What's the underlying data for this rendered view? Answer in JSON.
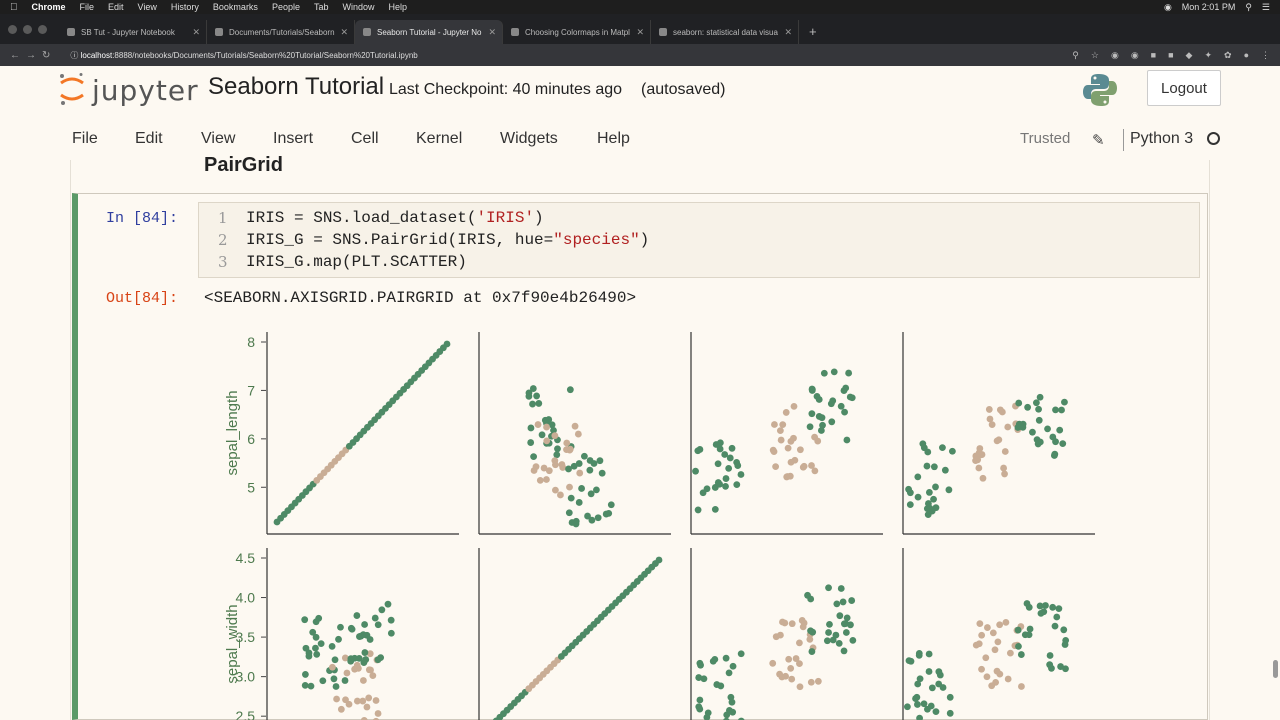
{
  "os_menubar": {
    "app": "Chrome",
    "items": [
      "File",
      "Edit",
      "View",
      "History",
      "Bookmarks",
      "People",
      "Tab",
      "Window",
      "Help"
    ],
    "clock": "Mon 2:01 PM"
  },
  "browser": {
    "tabs": [
      {
        "title": "SB Tut - Jupyter Notebook",
        "active": false
      },
      {
        "title": "Documents/Tutorials/Seaborn",
        "active": false
      },
      {
        "title": "Seaborn Tutorial - Jupyter No",
        "active": true
      },
      {
        "title": "Choosing Colormaps in Matpl",
        "active": false
      },
      {
        "title": "seaborn: statistical data visua",
        "active": false
      }
    ],
    "url_host": "localhost",
    "url_rest": ":8888/notebooks/Documents/Tutorials/Seaborn%20Tutorial/Seaborn%20Tutorial.ipynb"
  },
  "jupyter": {
    "logo_text": "jupyter",
    "notebook_title": "Seaborn Tutorial",
    "checkpoint": "Last Checkpoint: 40 minutes ago",
    "autosaved": "(autosaved)",
    "logout": "Logout",
    "menu": [
      "File",
      "Edit",
      "View",
      "Insert",
      "Cell",
      "Kernel",
      "Widgets",
      "Help"
    ],
    "trusted": "Trusted",
    "kernel_name": "Python 3"
  },
  "notebook": {
    "heading": "PairGrid",
    "in_prompt": "In [84]:",
    "code_lines": [
      {
        "n": "1",
        "text": "IRIS = SNS.load_dataset(",
        "str": "'IRIS'",
        "tail": ")"
      },
      {
        "n": "2",
        "text": "IRIS_G = SNS.PairGrid(IRIS, hue=",
        "str": "\"species\"",
        "tail": ")"
      },
      {
        "n": "3",
        "text": "IRIS_G.map(PLT.SCATTER)",
        "str": "",
        "tail": ""
      }
    ],
    "out_prompt": "Out[84]:",
    "out_text": "<SEABORN.AXISGRID.PAIRGRID at 0x7f90e4b26490>"
  },
  "chart_data": {
    "type": "scatter",
    "colors": {
      "setosa_like": "#4e8a66",
      "versicolor_like": "#c9ad95"
    },
    "rows": [
      {
        "ylabel": "sepal_length",
        "ylim": [
          4.2,
          8.0
        ],
        "yticks": [
          "8",
          "7",
          "6",
          "5"
        ],
        "ytick_values": [
          8,
          7,
          6,
          5
        ]
      },
      {
        "ylabel": "sepal_width",
        "ylim": [
          2.3,
          4.5
        ],
        "yticks": [
          "4.5",
          "4.0",
          "3.5",
          "3.0",
          "2.5"
        ],
        "ytick_values": [
          4.5,
          4.0,
          3.5,
          3.0,
          2.5
        ]
      }
    ],
    "columns": 4
  }
}
